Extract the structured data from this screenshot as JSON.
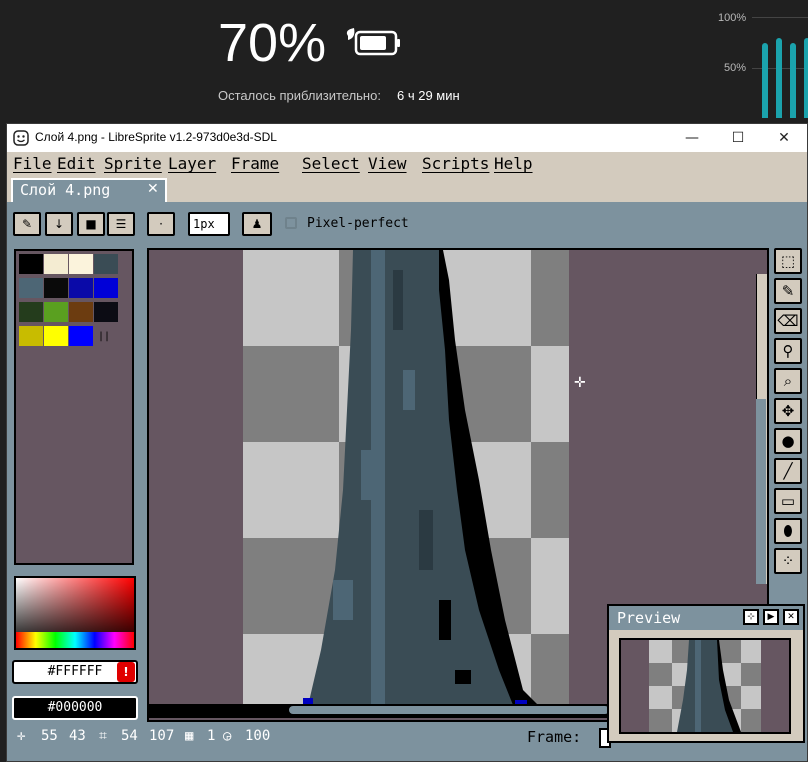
{
  "battery": {
    "percent": "70%",
    "remaining_label": "Осталось приблизительно:",
    "remaining_time": "6 ч 29 мин",
    "chart_y_labels": [
      "100%",
      "50%"
    ],
    "chart_bar_levels": [
      0.75,
      0.8,
      0.75,
      0.8
    ],
    "accent": "#1ba3ad"
  },
  "window": {
    "title": "Слой 4.png - LibreSprite v1.2-973d0e3d-SDL",
    "controls": {
      "minimize": "—",
      "maximize": "☐",
      "close": "✕"
    }
  },
  "menu": [
    "File",
    "Edit",
    "Sprite",
    "Layer",
    "Frame",
    "Select",
    "View",
    "Scripts",
    "Help"
  ],
  "tab": {
    "label": "Слой 4.png",
    "close": "✕"
  },
  "toolbar": {
    "brush_size": "1px",
    "pixel_perfect_label": "Pixel-perfect"
  },
  "palette": {
    "swatches": [
      "#000000",
      "#f4ecd2",
      "#fbf3dc",
      "#3a4c55",
      "#4d6675",
      "#0a0a0a",
      "#0a0aa8",
      "#0000d8",
      "#243c1c",
      "#5aa020",
      "#6c3c10",
      "#0c0c14",
      "#c8bc00",
      "#ffff00",
      "#0000ff"
    ],
    "fg_hex": "#FFFFFF",
    "bg_hex": "#000000"
  },
  "status": {
    "x": "55",
    "y": "43",
    "w": "54",
    "h": "107",
    "frame": "1",
    "zoom": "100",
    "frame_label": "Frame:"
  },
  "preview": {
    "title": "Preview"
  },
  "colors": {
    "panel": "#7d929e",
    "dark": "#665661",
    "light": "#d3cbbe"
  }
}
